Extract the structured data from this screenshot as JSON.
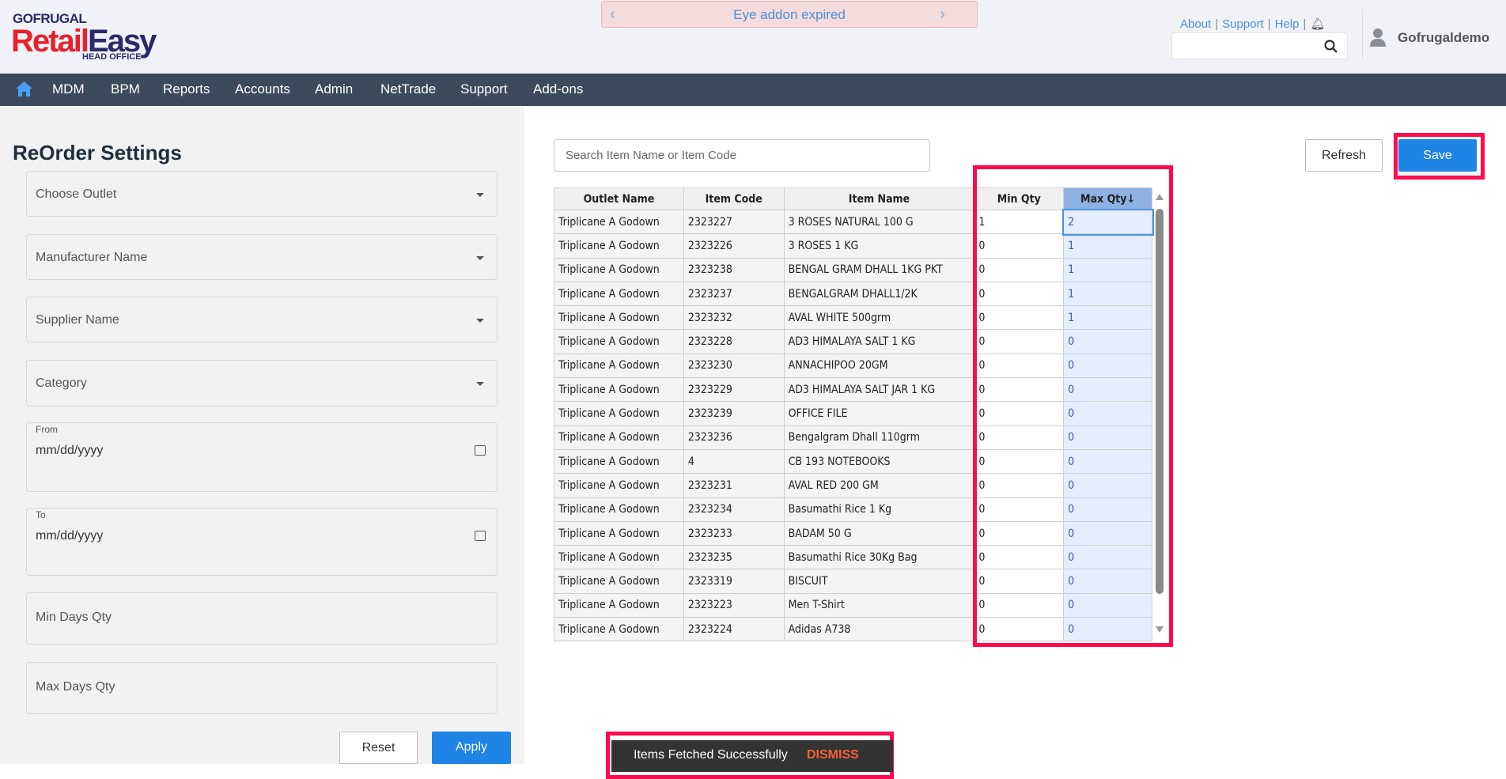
{
  "logo": {
    "brand": "GOFRUGAL",
    "product_a": "Retail",
    "product_b": "Easy",
    "sub": "HEAD OFFICE"
  },
  "banner": {
    "text": "Eye addon expired"
  },
  "toplinks": {
    "about": "About",
    "support": "Support",
    "help": "Help"
  },
  "user": {
    "name": "Gofrugaldemo"
  },
  "nav": [
    "MDM",
    "BPM",
    "Reports",
    "Accounts",
    "Admin",
    "NetTrade",
    "Support",
    "Add-ons"
  ],
  "left": {
    "title": "ReOrder Settings",
    "outlet": "Choose Outlet",
    "manufacturer": "Manufacturer Name",
    "supplier": "Supplier Name",
    "category": "Category",
    "from_label": "From",
    "from_ph": "mm/dd/yyyy",
    "to_label": "To",
    "to_ph": "mm/dd/yyyy",
    "min_days": "Min Days Qty",
    "max_days": "Max Days Qty",
    "reset": "Reset",
    "apply": "Apply"
  },
  "main": {
    "search_placeholder": "Search Item Name or Item Code",
    "refresh": "Refresh",
    "save": "Save"
  },
  "table": {
    "headers": [
      "Outlet Name",
      "Item Code",
      "Item Name",
      "Min Qty",
      "Max Qty"
    ],
    "sort_indicator": "↓",
    "rows": [
      [
        "Triplicane A Godown",
        "2323227",
        "3 ROSES NATURAL 100 G",
        "1",
        "2"
      ],
      [
        "Triplicane A Godown",
        "2323226",
        "3 ROSES 1 KG",
        "0",
        "1"
      ],
      [
        "Triplicane A Godown",
        "2323238",
        "BENGAL GRAM DHALL 1KG PKT",
        "0",
        "1"
      ],
      [
        "Triplicane A Godown",
        "2323237",
        "BENGALGRAM DHALL1/2K",
        "0",
        "1"
      ],
      [
        "Triplicane A Godown",
        "2323232",
        "AVAL WHITE 500grm",
        "0",
        "1"
      ],
      [
        "Triplicane A Godown",
        "2323228",
        "AD3 HIMALAYA SALT 1 KG",
        "0",
        "0"
      ],
      [
        "Triplicane A Godown",
        "2323230",
        "ANNACHIPOO 20GM",
        "0",
        "0"
      ],
      [
        "Triplicane A Godown",
        "2323229",
        "AD3 HIMALAYA SALT JAR 1 KG",
        "0",
        "0"
      ],
      [
        "Triplicane A Godown",
        "2323239",
        "OFFICE FILE",
        "0",
        "0"
      ],
      [
        "Triplicane A Godown",
        "2323236",
        "Bengalgram Dhall 110grm",
        "0",
        "0"
      ],
      [
        "Triplicane A Godown",
        "4",
        "CB 193 NOTEBOOKS",
        "0",
        "0"
      ],
      [
        "Triplicane A Godown",
        "2323231",
        "AVAL RED 200 GM",
        "0",
        "0"
      ],
      [
        "Triplicane A Godown",
        "2323234",
        "Basumathi Rice 1 Kg",
        "0",
        "0"
      ],
      [
        "Triplicane A Godown",
        "2323233",
        "BADAM 50 G",
        "0",
        "0"
      ],
      [
        "Triplicane A Godown",
        "2323235",
        "Basumathi Rice 30Kg Bag",
        "0",
        "0"
      ],
      [
        "Triplicane A Godown",
        "2323319",
        "BISCUIT",
        "0",
        "0"
      ],
      [
        "Triplicane A Godown",
        "2323223",
        "Men T-Shirt",
        "0",
        "0"
      ],
      [
        "Triplicane A Godown",
        "2323224",
        "Adidas A738",
        "0",
        "0"
      ]
    ]
  },
  "toast": {
    "message": "Items Fetched Successfully",
    "action": "DISMISS"
  }
}
